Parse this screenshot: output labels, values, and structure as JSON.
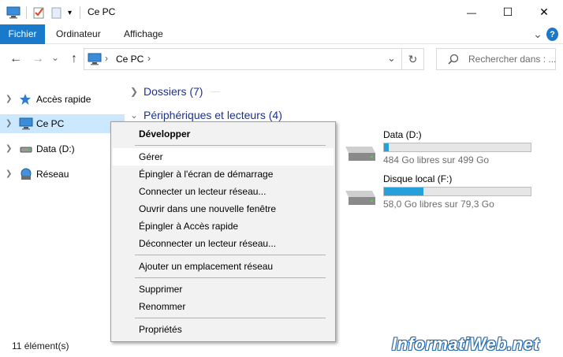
{
  "window": {
    "title": "Ce PC",
    "minimize_glyph": "—",
    "maximize_glyph": "☐",
    "close_glyph": "✕"
  },
  "ribbon": {
    "tabs": [
      "Fichier",
      "Ordinateur",
      "Affichage"
    ],
    "collapse_glyph": "⌄",
    "help_glyph": "?"
  },
  "navigation": {
    "back_glyph": "←",
    "forward_glyph": "→",
    "recent_glyph": "⌄",
    "up_glyph": "↑",
    "address": "Ce PC",
    "address_separator": "›",
    "dropdown_glyph": "⌄",
    "refresh_glyph": "↻",
    "search_placeholder": "Rechercher dans : ..."
  },
  "sidebar": {
    "items": [
      {
        "label": "Accès rapide",
        "icon": "star-icon",
        "selected": false
      },
      {
        "label": "Ce PC",
        "icon": "computer-icon",
        "selected": true
      },
      {
        "label": "Data (D:)",
        "icon": "drive-icon",
        "selected": false
      },
      {
        "label": "Réseau",
        "icon": "network-icon",
        "selected": false
      }
    ]
  },
  "main": {
    "groups": [
      {
        "title": "Dossiers (7)",
        "expanded": false
      },
      {
        "title": "Périphériques et lecteurs (4)",
        "expanded": true
      }
    ],
    "drives": [
      {
        "name": "Data (D:)",
        "free": "484 Go libres sur 499 Go",
        "used_fraction": 0.03
      },
      {
        "name": "Disque local (F:)",
        "free": "58,0 Go libres sur 79,3 Go",
        "used_fraction": 0.27
      }
    ]
  },
  "status": {
    "count": "11 élément(s)"
  },
  "context_menu": {
    "items": [
      {
        "label": "Développer",
        "bold": true,
        "hover": false
      },
      {
        "separator": true
      },
      {
        "label": "Gérer",
        "bold": false,
        "hover": true
      },
      {
        "label": "Épingler à l'écran de démarrage",
        "bold": false,
        "hover": false
      },
      {
        "label": "Connecter un lecteur réseau...",
        "bold": false,
        "hover": false
      },
      {
        "label": "Ouvrir dans une nouvelle fenêtre",
        "bold": false,
        "hover": false
      },
      {
        "label": "Épingler à Accès rapide",
        "bold": false,
        "hover": false
      },
      {
        "label": "Déconnecter un lecteur réseau...",
        "bold": false,
        "hover": false
      },
      {
        "separator": true
      },
      {
        "label": "Ajouter un emplacement réseau",
        "bold": false,
        "hover": false
      },
      {
        "separator": true
      },
      {
        "label": "Supprimer",
        "bold": false,
        "hover": false
      },
      {
        "label": "Renommer",
        "bold": false,
        "hover": false
      },
      {
        "separator": true
      },
      {
        "label": "Propriétés",
        "bold": false,
        "hover": false
      }
    ]
  },
  "watermark": "InformatiWeb.net",
  "colors": {
    "accent": "#1979ca",
    "selection": "#cce8ff",
    "drive_fill": "#26a0da",
    "group_title": "#1e3287"
  }
}
